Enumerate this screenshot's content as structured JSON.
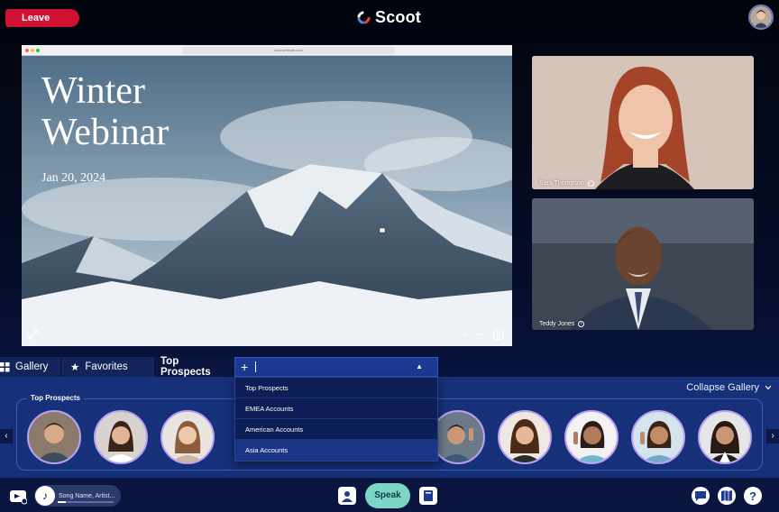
{
  "header": {
    "leave_label": "Leave",
    "brand_name": "Scoot"
  },
  "share": {
    "url": "www.website.com",
    "slide_title_line1": "Winter",
    "slide_title_line2": "Webinar",
    "slide_date": "Jan 20, 2024",
    "zoom_in": "+",
    "zoom_out": "−"
  },
  "videos": [
    {
      "name": "Sara Thompson"
    },
    {
      "name": "Teddy Jones"
    }
  ],
  "tabs": {
    "gallery": "Gallery",
    "favorites": "Favorites",
    "top_prospects": "Top Prospects",
    "add": "+"
  },
  "gallery": {
    "section_label": "Top Prospects",
    "collapse_label": "Collapse Gallery",
    "prev": "‹",
    "next": "›"
  },
  "dropdown": {
    "items": [
      {
        "label": "Top Prospects"
      },
      {
        "label": "EMEA Accounts"
      },
      {
        "label": "American Accounts"
      },
      {
        "label": "Asia Accounts"
      }
    ]
  },
  "bottom": {
    "song_placeholder": "Song Name, Artist...",
    "speak_label": "Speak",
    "music_progress": 0.14
  },
  "colors": {
    "leave": "#cf1132",
    "speak": "#7cd6c6",
    "avatar_ring": "#b9a0f2"
  }
}
